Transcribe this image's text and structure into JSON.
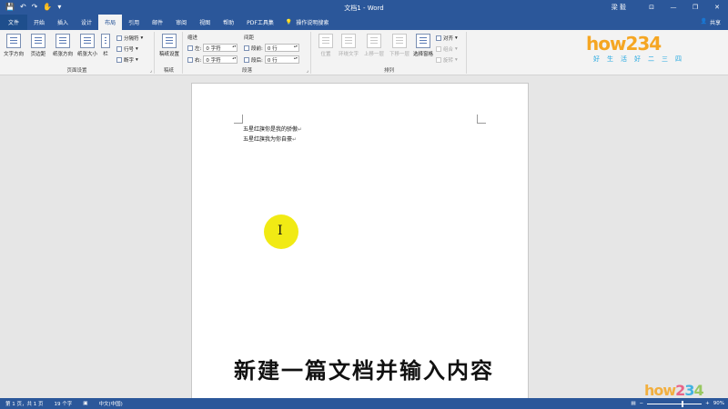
{
  "window": {
    "title": "文档1 - Word",
    "user": "梁 毅",
    "minimize": "—",
    "restore": "❐",
    "close": "✕"
  },
  "qat": {
    "save": "💾",
    "undo": "↶",
    "redo": "↷",
    "touch": "✋",
    "more": "▾"
  },
  "tabs": {
    "file": "文件",
    "items": [
      "开始",
      "插入",
      "设计",
      "布局",
      "引用",
      "邮件",
      "审阅",
      "视图",
      "帮助",
      "PDF工具集"
    ],
    "active_index": 3,
    "tell_me": "操作说明搜索",
    "share": "共享"
  },
  "ribbon": {
    "page_setup": {
      "label": "页面设置",
      "text_direction": "文字方向",
      "margins": "页边距",
      "orientation": "纸张方向",
      "size": "纸张大小",
      "columns": "栏",
      "breaks": "分隔符",
      "line_numbers": "行号",
      "hyphenation": "断字"
    },
    "draft": {
      "label": "稿纸",
      "button": "稿纸设置"
    },
    "paragraph": {
      "label": "段落",
      "indent_label": "缩进",
      "spacing_label": "间距",
      "left_label": "左:",
      "right_label": "右:",
      "before_label": "段前:",
      "after_label": "段后:",
      "left_value": "0 字符",
      "right_value": "0 字符",
      "before_value": "0 行",
      "after_value": "0 行"
    },
    "arrange": {
      "label": "排列",
      "position": "位置",
      "wrap_text": "环绕文字",
      "bring_forward": "上移一层",
      "send_backward": "下移一层",
      "selection_pane": "选择窗格",
      "align": "对齐",
      "group": "组合",
      "rotate": "旋转"
    }
  },
  "logo": {
    "brand": "how234",
    "slogan": "好生活好二三四"
  },
  "document": {
    "lines": [
      "五星红旗你是我的骄傲",
      "五星红旗我为你自豪"
    ],
    "para_mark": "↵"
  },
  "subtitle": "新建一篇文档并输入内容",
  "statusbar": {
    "page": "第 1 页，共 1 页",
    "words": "19 个字",
    "language": "中文(中国)",
    "zoom": "90%"
  }
}
